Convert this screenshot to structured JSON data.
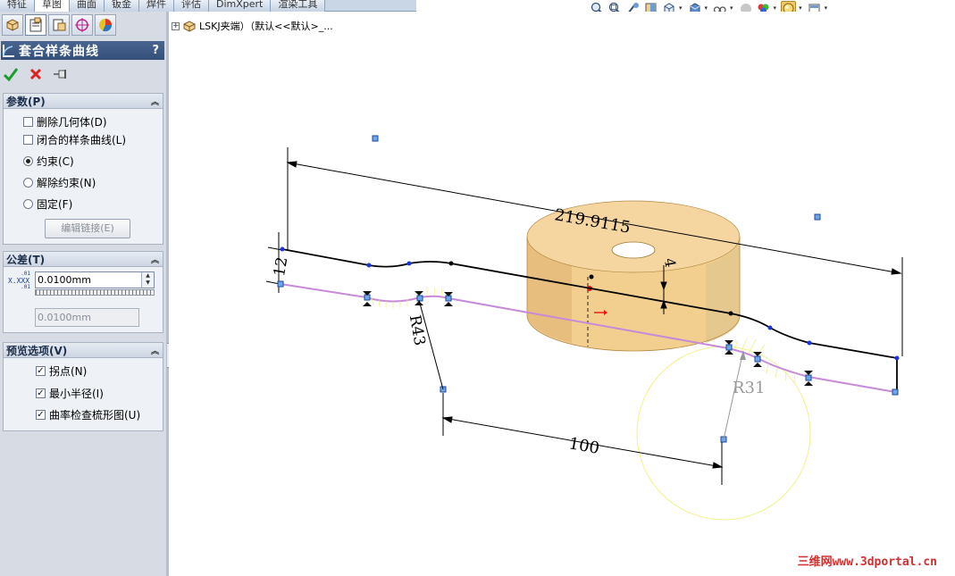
{
  "tabs": [
    {
      "label": "特征"
    },
    {
      "label": "草图"
    },
    {
      "label": "曲面"
    },
    {
      "label": "钣金"
    },
    {
      "label": "焊件"
    },
    {
      "label": "评估"
    },
    {
      "label": "DimXpert"
    },
    {
      "label": "渲染工具"
    }
  ],
  "hud_icons": [
    "zoom-to-fit-icon",
    "zoom-to-area-icon",
    "previous-view-icon",
    "section-view-icon",
    "view-orientation-icon",
    "display-style-icon",
    "hide-show-items-icon",
    "edit-appearance-icon",
    "apply-scene-icon",
    "view-settings-icon",
    "realview-icon"
  ],
  "property_manager": {
    "title": "套合样条曲线",
    "help": "?",
    "params": {
      "header": "参数(P)",
      "delete_geometry": "删除几何体(D)",
      "closed_spline": "闭合的样条曲线(L)",
      "constrained": "约束(C)",
      "unconstrained": "解除约束(N)",
      "fixed": "固定(F)",
      "edit_link": "编辑链接(E)"
    },
    "tolerance": {
      "header": "公差(T)",
      "icon_text_top": ".01",
      "icon_text_mid": "X.XXX",
      "icon_text_bot": ".01",
      "value": "0.0100mm",
      "result": "0.0100mm"
    },
    "preview": {
      "header": "预览选项(V)",
      "inflection": "拐点(N)",
      "min_radius": "最小半径(I)",
      "curvature_comb": "曲率检查梳形图(U)"
    }
  },
  "feature_tree": {
    "expand": "+",
    "part_label": "LSKJ夹端）（默认<<默认>_..."
  },
  "dimensions": {
    "overall": "219.9115",
    "offset": "12",
    "height": "4",
    "radius_left": "R43",
    "radius_right": "R31",
    "distance": "100"
  },
  "colors": {
    "sketch_line": "#000000",
    "spline_preview": "#c78ad8",
    "cylinder": "#f2cf8f",
    "cylinder_dark": "#d9ab63",
    "curvature_comb": "#f3f08a",
    "watermark": "#d23030"
  },
  "watermark": "三维网www.3dportal.cn"
}
